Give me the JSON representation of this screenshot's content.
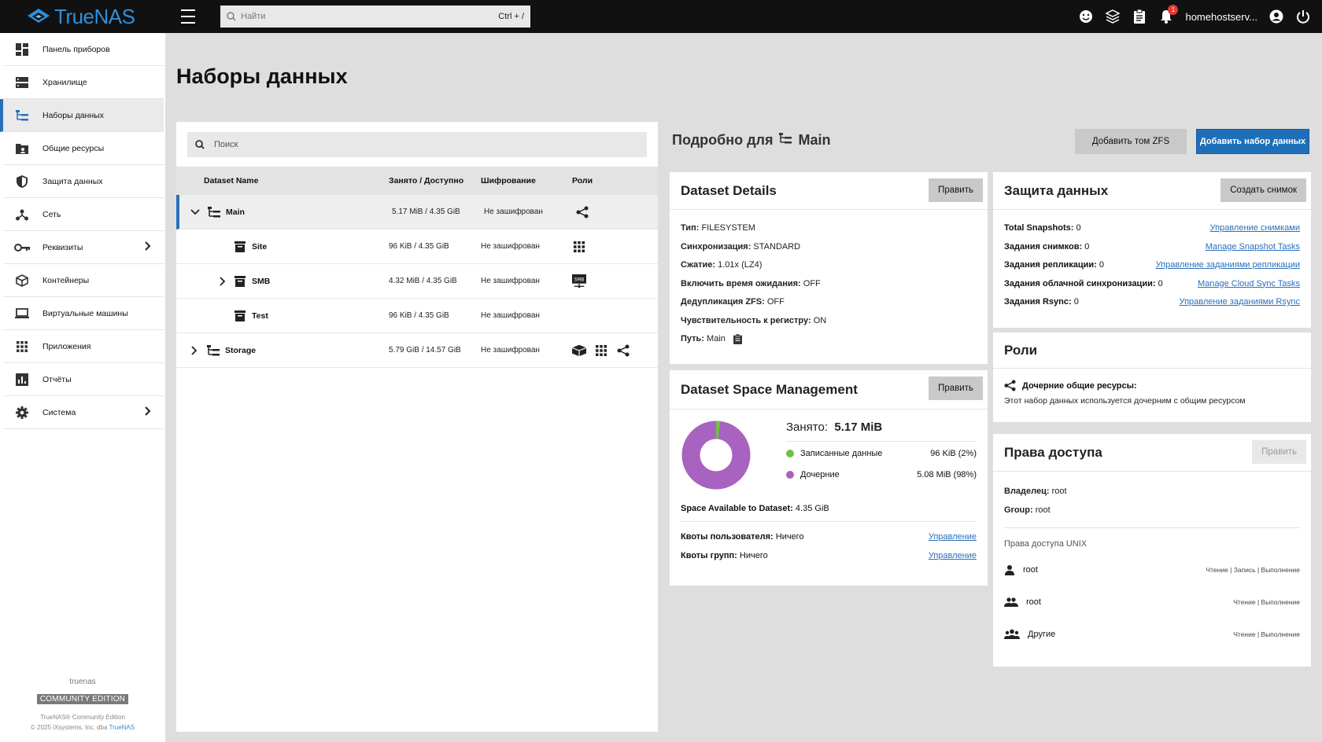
{
  "topbar": {
    "logo_text": "TrueNAS",
    "search_placeholder": "Найти",
    "search_shortcut": "Ctrl + /",
    "notification_count": "1",
    "username": "homehostserv..."
  },
  "sidebar": {
    "items": [
      {
        "label": "Панель приборов",
        "icon": "dashboard-icon"
      },
      {
        "label": "Хранилище",
        "icon": "storage-icon"
      },
      {
        "label": "Наборы данных",
        "icon": "datasets-icon"
      },
      {
        "label": "Общие ресурсы",
        "icon": "shares-icon"
      },
      {
        "label": "Защита данных",
        "icon": "shield-icon"
      },
      {
        "label": "Сеть",
        "icon": "network-icon"
      },
      {
        "label": "Реквизиты",
        "icon": "key-icon"
      },
      {
        "label": "Контейнеры",
        "icon": "containers-icon"
      },
      {
        "label": "Виртуальные машины",
        "icon": "laptop-icon"
      },
      {
        "label": "Приложения",
        "icon": "apps-icon"
      },
      {
        "label": "Отчёты",
        "icon": "reports-icon"
      },
      {
        "label": "Система",
        "icon": "gear-icon"
      }
    ],
    "hostname": "truenas",
    "edition_badge": "COMMUNITY EDITION",
    "copyright_line1": "TrueNAS® Community Edition",
    "copyright_line2": "© 2025 iXsystems, Inc. dba",
    "copyright_link": "TrueNAS"
  },
  "page": {
    "title": "Наборы данных"
  },
  "tree": {
    "search_placeholder": "Поиск",
    "headers": {
      "name": "Dataset Name",
      "used": "Занято / Доступно",
      "encryption": "Шифрование",
      "roles": "Роли"
    },
    "rows": [
      {
        "name": "Main",
        "used": "5.17 MiB / 4.35 GiB",
        "encryption": "Не зашифрован"
      },
      {
        "name": "Site",
        "used": "96 KiB / 4.35 GiB",
        "encryption": "Не зашифрован"
      },
      {
        "name": "SMB",
        "used": "4.32 MiB / 4.35 GiB",
        "encryption": "Не зашифрован"
      },
      {
        "name": "Test",
        "used": "96 KiB / 4.35 GiB",
        "encryption": "Не зашифрован"
      },
      {
        "name": "Storage",
        "used": "5.79 GiB / 14.57 GiB",
        "encryption": "Не зашифрован"
      }
    ]
  },
  "details": {
    "title_prefix": "Подробно для",
    "title_dataset": "Main",
    "add_zvol": "Добавить том ZFS",
    "add_dataset": "Добавить набор данных"
  },
  "dataset_details": {
    "title": "Dataset Details",
    "edit": "Править",
    "type_label": "Тип:",
    "type_value": "FILESYSTEM",
    "sync_label": "Синхронизация:",
    "sync_value": "STANDARD",
    "compression_label": "Сжатие:",
    "compression_value": "1.01x (LZ4)",
    "atime_label": "Включить время ожидания:",
    "atime_value": "OFF",
    "dedup_label": "Дедупликация ZFS:",
    "dedup_value": "OFF",
    "case_label": "Чувствительность к регистру:",
    "case_value": "ON",
    "path_label": "Путь:",
    "path_value": "Main"
  },
  "space": {
    "title": "Dataset Space Management",
    "edit": "Править",
    "used_label": "Занято:",
    "used_value": "5.17 MiB",
    "written_label": "Записанные данные",
    "written_value": "96 KiB (2%)",
    "children_label": "Дочерние",
    "children_value": "5.08 MiB (98%)",
    "available_label": "Space Available to Dataset:",
    "available_value": "4.35 GiB",
    "user_quota_label": "Квоты пользователя:",
    "user_quota_value": "Ничего",
    "user_quota_link": "Управление",
    "group_quota_label": "Квоты групп:",
    "group_quota_value": "Ничего",
    "group_quota_link": "Управление",
    "written_pct": 2,
    "children_pct": 98,
    "written_color": "#71bf44",
    "children_color": "#a862bf"
  },
  "protection": {
    "title": "Защита данных",
    "snapshot_btn": "Создать снимок",
    "rows": [
      {
        "label": "Total Snapshots:",
        "value": "0",
        "link": "Управление снимками"
      },
      {
        "label": "Задания снимков:",
        "value": "0",
        "link": "Manage Snapshot Tasks"
      },
      {
        "label": "Задания репликации:",
        "value": "0",
        "link": "Управление заданиями репликации"
      },
      {
        "label": "Задания облачной синхронизации:",
        "value": "0",
        "link": "Manage Cloud Sync Tasks"
      },
      {
        "label": "Задания Rsync:",
        "value": "0",
        "link": "Управление заданиями Rsync"
      }
    ]
  },
  "roles": {
    "title": "Роли",
    "child_shares_label": "Дочерние общие ресурсы:",
    "child_shares_desc": "Этот набор данных используется дочерним с общим ресурсом"
  },
  "permissions": {
    "title": "Права доступа",
    "edit": "Править",
    "owner_label": "Владелец:",
    "owner_value": "root",
    "group_label": "Group:",
    "group_value": "root",
    "unix_label": "Права доступа UNIX",
    "entries": [
      {
        "name": "root",
        "perms": "Чтение | Запись | Выполнение"
      },
      {
        "name": "root",
        "perms": "Чтение | Выполнение"
      },
      {
        "name": "Другие",
        "perms": "Чтение | Выполнение"
      }
    ]
  }
}
